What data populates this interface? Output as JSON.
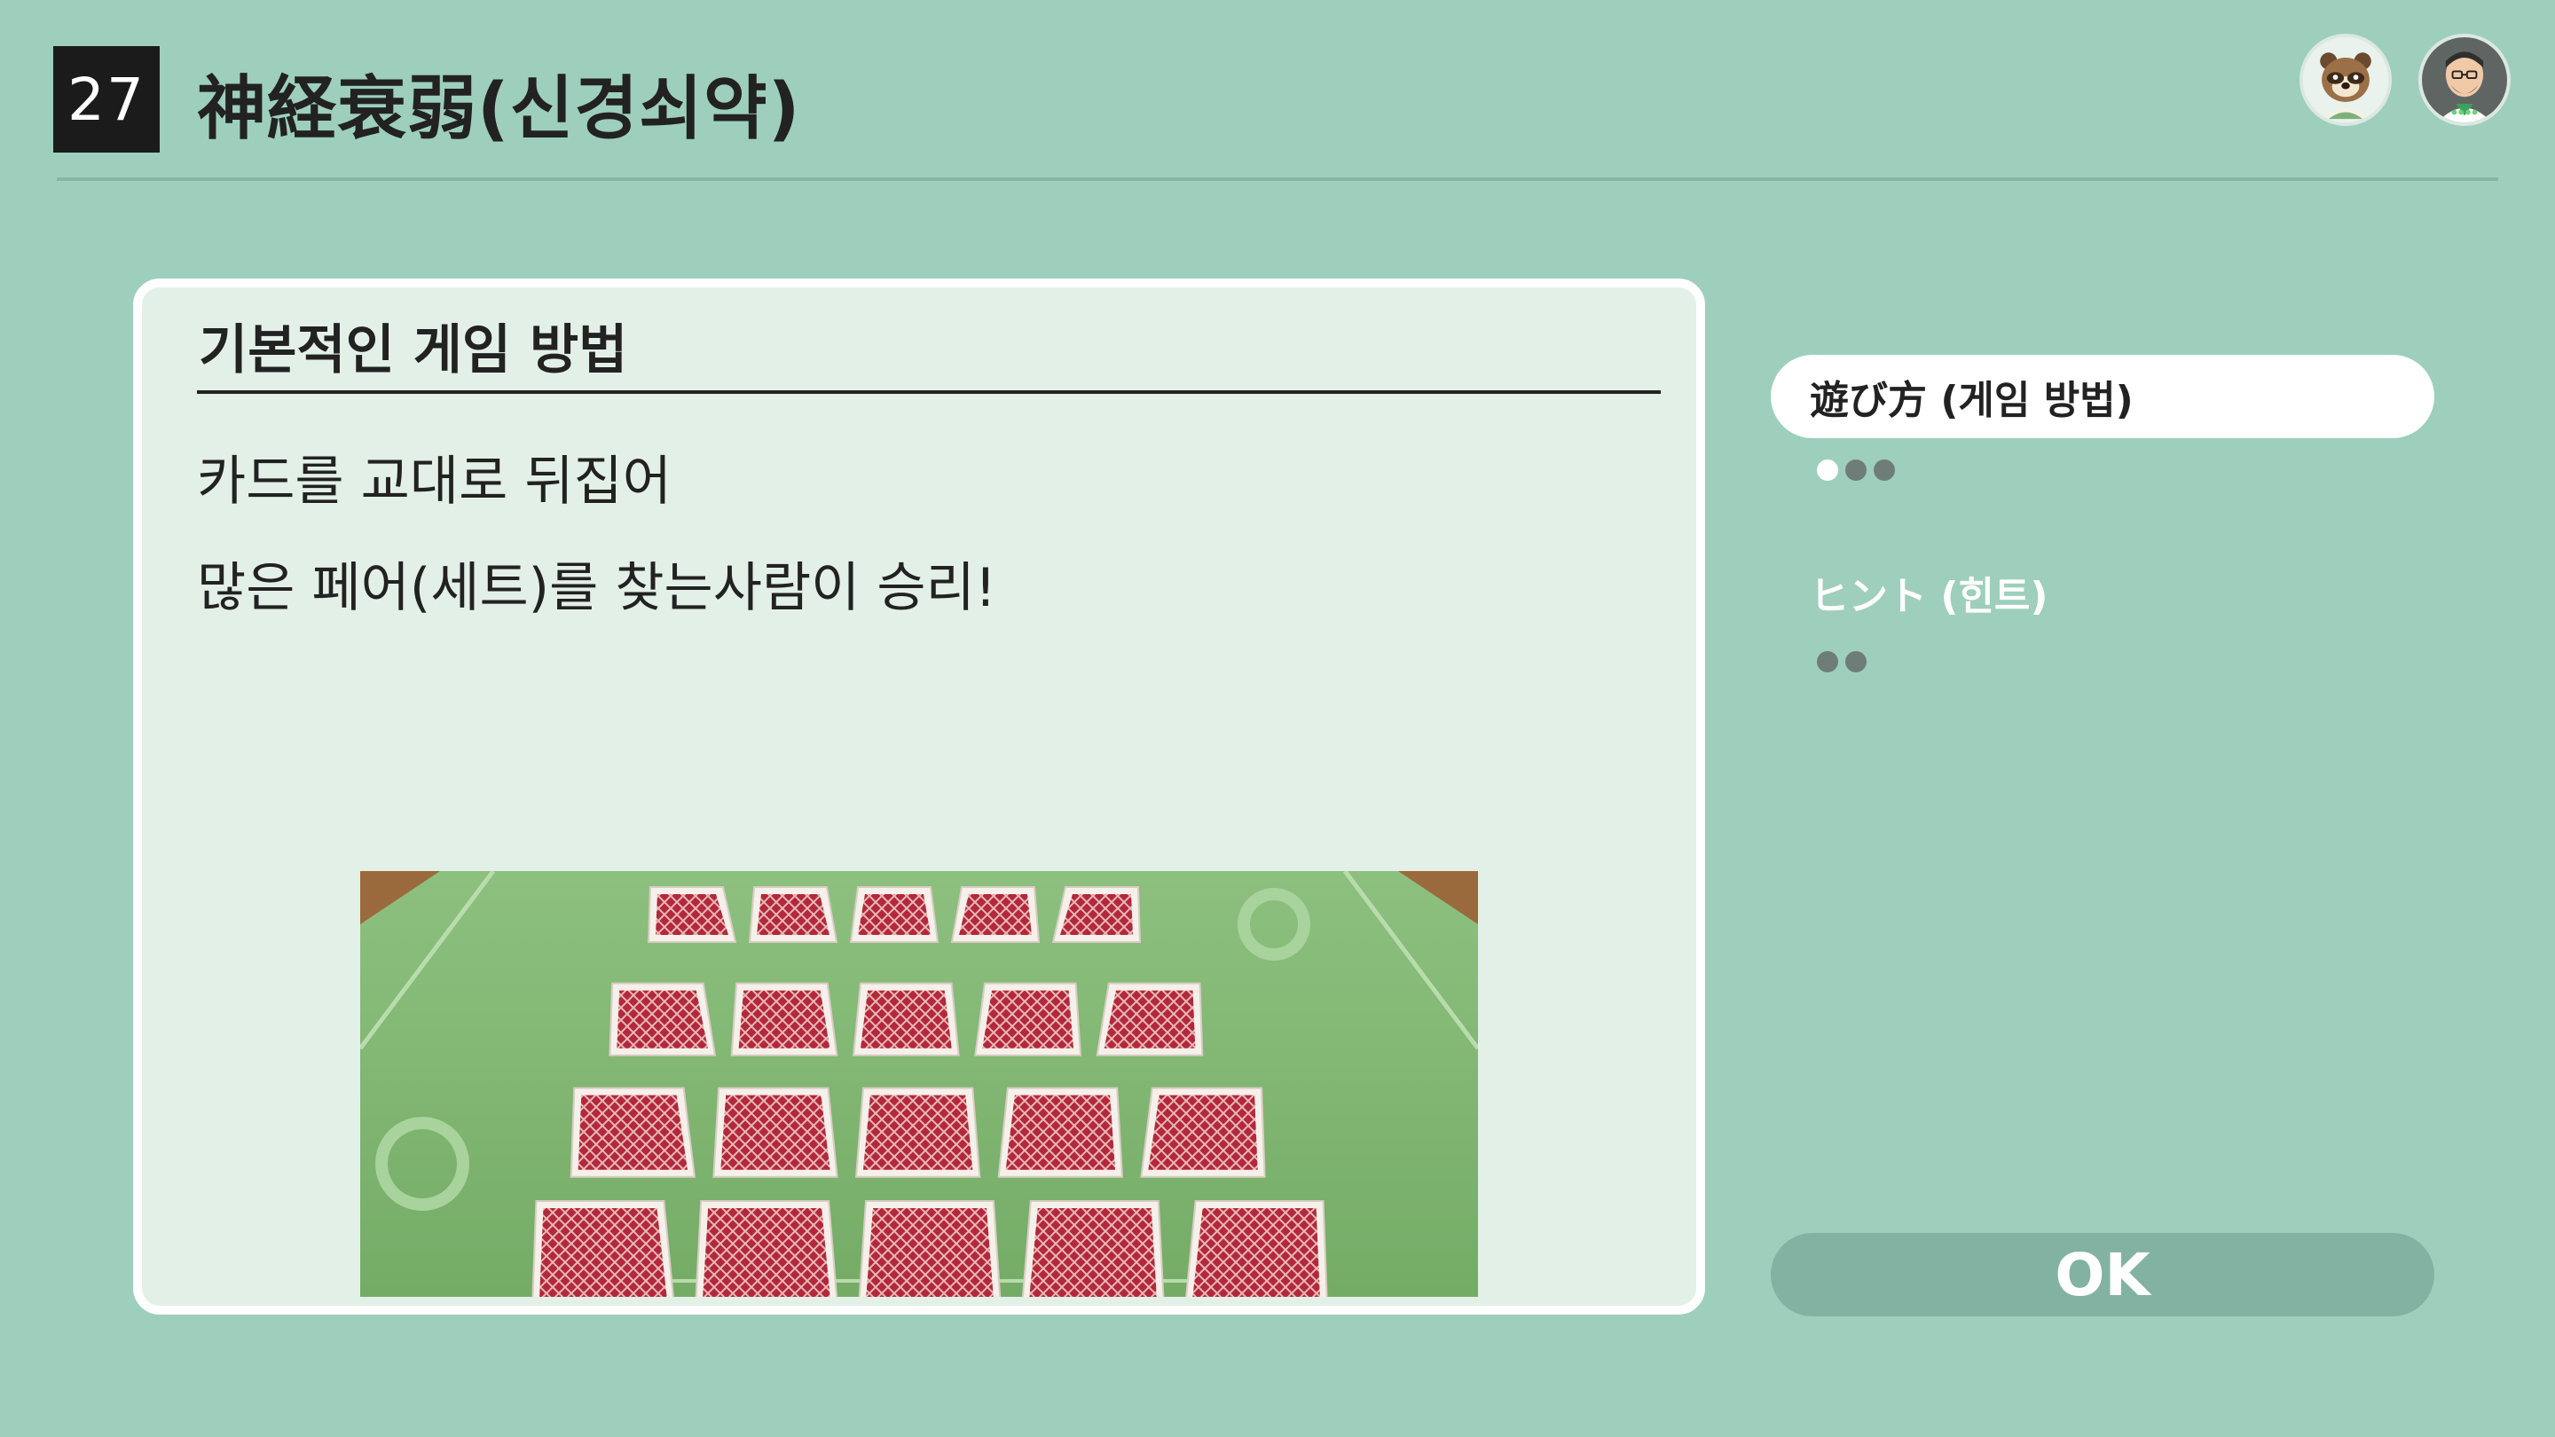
{
  "header": {
    "number": "27",
    "title": "神経衰弱(신경쇠약)"
  },
  "avatars": [
    {
      "name": "raccoon-character"
    },
    {
      "name": "mii-character"
    }
  ],
  "panel": {
    "heading": "기본적인 게임 방법",
    "lines": [
      "카드를 교대로 뒤집어",
      "많은 페어(세트)를 찾는사람이 승리!"
    ],
    "card_rows": [
      5,
      5,
      5,
      5
    ]
  },
  "menu": {
    "items": [
      {
        "label": "遊び方 (게임 방법)",
        "pages": 3,
        "current_page": 1,
        "selected": true
      },
      {
        "label": "ヒント (힌트)",
        "pages": 2,
        "current_page": 0,
        "selected": false
      }
    ]
  },
  "ok_button": {
    "label": "OK"
  },
  "colors": {
    "background": "#9dcfbc",
    "panel": "#e3f0e7",
    "card_red": "#b3283a",
    "table_felt": "#7fb46f"
  }
}
